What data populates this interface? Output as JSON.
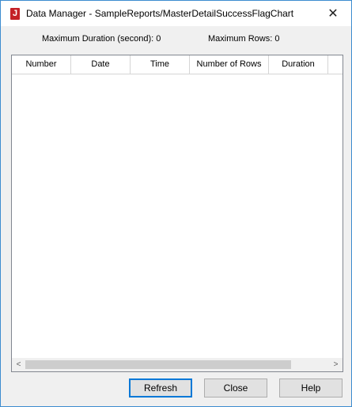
{
  "window": {
    "title": "Data Manager - SampleReports/MasterDetailSuccessFlagChart",
    "icon": "app-logo-icon",
    "icon_letter": "J",
    "close_glyph": "✕"
  },
  "info": {
    "max_duration": "Maximum Duration (second): 0",
    "max_rows": "Maximum Rows: 0"
  },
  "table": {
    "columns": [
      "Number",
      "Date",
      "Time",
      "Number of Rows",
      "Duration"
    ],
    "rows": []
  },
  "scrollbar": {
    "left_arrow": "<",
    "right_arrow": ">"
  },
  "buttons": {
    "refresh": "Refresh",
    "close": "Close",
    "help": "Help"
  },
  "colors": {
    "border_accent": "#3c8cd0",
    "icon_red": "#c42026",
    "default_button_border": "#0078d7"
  }
}
